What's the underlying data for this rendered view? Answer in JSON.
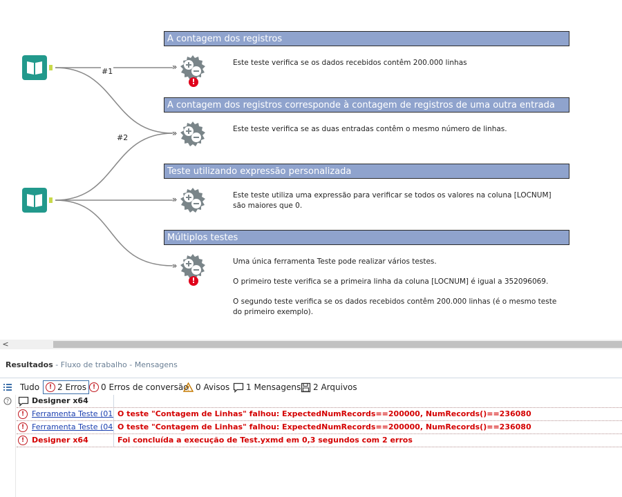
{
  "containers": [
    {
      "title": "A contagem dos registros",
      "description": [
        "Este teste verifica se os dados recebidos contêm 200.000 linhas"
      ]
    },
    {
      "title": "A contagem dos registros corresponde à contagem de registros de uma outra entrada",
      "description": [
        "Este teste verifica se as duas entradas contêm o mesmo número de linhas."
      ]
    },
    {
      "title": "Teste utilizando expressão personalizada",
      "description": [
        "Este teste utiliza uma expressão para verificar se todos os valores na coluna [LOCNUM] são maiores que 0."
      ]
    },
    {
      "title": "Múltiplos testes",
      "description": [
        "Uma única ferramenta Teste pode realizar vários testes.",
        "O primeiro teste verifica se a primeira linha da coluna [LOCNUM] é igual a 352096069.",
        " O segundo teste verifica se os dados recebidos contêm 200.000 linhas (é o mesmo teste do primeiro exemplo)."
      ]
    }
  ],
  "connections": {
    "label_1": "#1",
    "label_2": "#2"
  },
  "anchors": {
    "input_glyph": "»"
  },
  "tool_icons": {
    "input": "book-input-icon",
    "test": "test-plus-minus-icon",
    "error": "!"
  },
  "results": {
    "title": "Resultados",
    "subtitle": " - Fluxo de trabalho - Mensagens",
    "filters": {
      "all": "Tudo",
      "errors": "2 Erros",
      "conversion_errors": "0 Erros de conversão",
      "warnings": "0 Avisos",
      "messages": "1 Mensagens",
      "files": "2 Arquivos"
    },
    "rows": [
      {
        "source": "Designer x64",
        "message": "",
        "type": "info"
      },
      {
        "source": "Ferramenta Teste (01)",
        "message": "O teste \"Contagem de Linhas\" falhou: ExpectedNumRecords==200000, NumRecords()==236080",
        "type": "error-link"
      },
      {
        "source": "Ferramenta Teste (04)",
        "message": "O teste \"Contagem de Linhas\" falhou: ExpectedNumRecords==200000, NumRecords()==236080",
        "type": "error-link"
      },
      {
        "source": "Designer x64",
        "message": "Foi concluída a execução de Test.yxmd em 0,3 segundos com 2 erros",
        "type": "error"
      }
    ]
  },
  "scrollbar": {
    "left_arrow": "<"
  },
  "colors": {
    "container_header": "#8fa3cd",
    "tool_teal": "#22998c",
    "test_gray": "#7a8589",
    "error_red": "#e0001b",
    "message_red": "#d40000",
    "link_blue": "#1a3fb0"
  }
}
